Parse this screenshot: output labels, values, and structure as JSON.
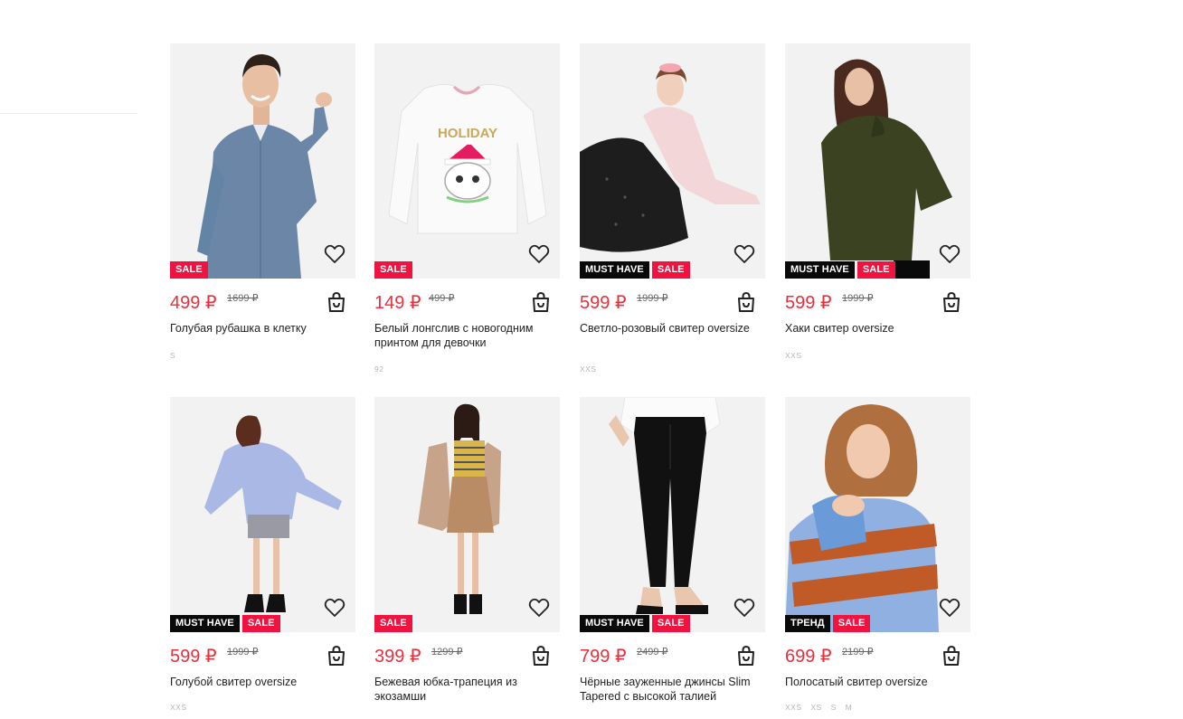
{
  "products": [
    {
      "title": "Голубая рубашка в клетку",
      "price": "499 ₽",
      "old_price": "1699 ₽",
      "badges": [
        {
          "text": "SALE",
          "type": "sale"
        }
      ],
      "sizes": [
        "S"
      ],
      "image": "man-in-checked-shirt"
    },
    {
      "title": "Белый лонгслив с новогодним принтом для девочки",
      "price": "149 ₽",
      "old_price": "499 ₽",
      "badges": [
        {
          "text": "SALE",
          "type": "sale"
        }
      ],
      "sizes": [
        "92"
      ],
      "image": "white-longsleeve-holiday-cat",
      "print_text": "HOLIDAY"
    },
    {
      "title": "Светло-розовый свитер oversize",
      "price": "599 ₽",
      "old_price": "1999 ₽",
      "badges": [
        {
          "text": "MUST HAVE",
          "type": "dark"
        },
        {
          "text": "SALE",
          "type": "sale"
        }
      ],
      "sizes": [
        "XXS"
      ],
      "image": "woman-in-pink-sweater-sitting"
    },
    {
      "title": "Хаки свитер oversize",
      "price": "599 ₽",
      "old_price": "1999 ₽",
      "badges": [
        {
          "text": "MUST HAVE",
          "type": "dark"
        },
        {
          "text": "SALE",
          "type": "sale"
        }
      ],
      "sizes": [
        "XXS"
      ],
      "image": "woman-in-khaki-sweater"
    },
    {
      "title": "Голубой свитер oversize",
      "price": "599 ₽",
      "old_price": "1999 ₽",
      "badges": [
        {
          "text": "MUST HAVE",
          "type": "dark"
        },
        {
          "text": "SALE",
          "type": "sale"
        }
      ],
      "sizes": [
        "XXS"
      ],
      "image": "woman-in-blue-sweater"
    },
    {
      "title": "Бежевая юбка-трапеция из экозамши",
      "price": "399 ₽",
      "old_price": "1299 ₽",
      "badges": [
        {
          "text": "SALE",
          "type": "sale"
        }
      ],
      "sizes": [],
      "image": "woman-in-beige-skirt"
    },
    {
      "title": "Чёрные зауженные джинсы Slim Tapered с высокой талией",
      "price": "799 ₽",
      "old_price": "2499 ₽",
      "badges": [
        {
          "text": "MUST HAVE",
          "type": "dark"
        },
        {
          "text": "SALE",
          "type": "sale"
        }
      ],
      "sizes": [],
      "image": "black-slim-jeans"
    },
    {
      "title": "Полосатый свитер oversize",
      "price": "699 ₽",
      "old_price": "2199 ₽",
      "badges": [
        {
          "text": "ТРЕНД",
          "type": "dark"
        },
        {
          "text": "SALE",
          "type": "sale"
        }
      ],
      "sizes": [
        "XXS",
        "XS",
        "S",
        "M"
      ],
      "image": "woman-in-striped-sweater"
    }
  ],
  "colors": {
    "price": "#e8303d",
    "sale": "#f0123f",
    "dark_badge": "#0a0a0a",
    "photo_bg": "#f2f2f2"
  },
  "icons": {
    "favorite": "heart-icon",
    "cart": "shopping-bag-icon"
  }
}
